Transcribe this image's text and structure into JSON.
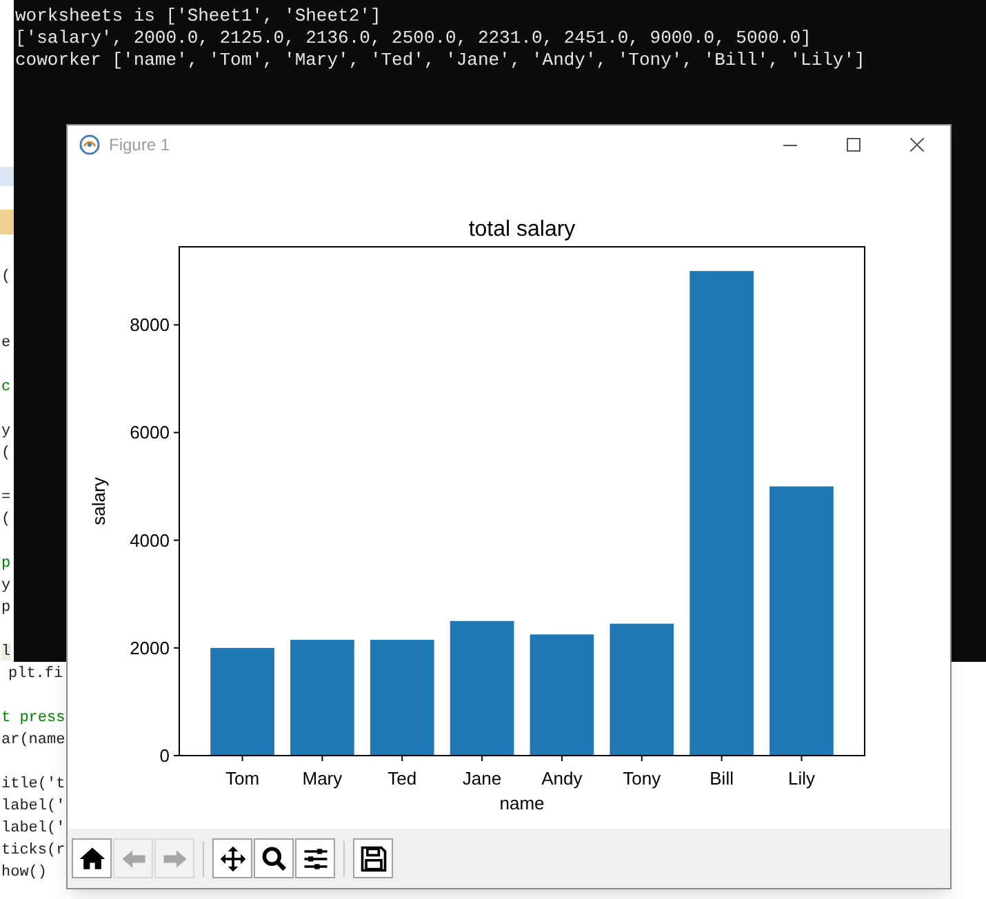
{
  "console": {
    "lines": [
      "worksheets is ['Sheet1', 'Sheet2']",
      "['salary', 2000.0, 2125.0, 2136.0, 2500.0, 2231.0, 2451.0, 9000.0, 5000.0]",
      "coworker ['name', 'Tom', 'Mary', 'Ted', 'Jane', 'Andy', 'Tony', 'Bill', 'Lily']"
    ]
  },
  "editor": {
    "lines": [
      {
        "kind": "code",
        "text": "("
      },
      {
        "kind": "blank"
      },
      {
        "kind": "blank"
      },
      {
        "kind": "code",
        "text": "e"
      },
      {
        "kind": "blank"
      },
      {
        "kind": "comment",
        "text": "c"
      },
      {
        "kind": "blank"
      },
      {
        "kind": "code",
        "text": "y"
      },
      {
        "kind": "code",
        "text": "("
      },
      {
        "kind": "blank"
      },
      {
        "kind": "code",
        "text": "="
      },
      {
        "kind": "code",
        "text": "("
      },
      {
        "kind": "blank"
      },
      {
        "kind": "comment",
        "text": "p"
      },
      {
        "kind": "code",
        "text": "y"
      },
      {
        "kind": "code",
        "text": "p"
      },
      {
        "kind": "blank"
      },
      {
        "kind": "current",
        "text": "l"
      },
      {
        "kind": "indented",
        "text": "plt.fi"
      },
      {
        "kind": "blank"
      },
      {
        "kind": "comment",
        "text": "t press"
      },
      {
        "kind": "code",
        "text": "ar(name"
      },
      {
        "kind": "blank"
      },
      {
        "kind": "code",
        "text": "itle('t"
      },
      {
        "kind": "code",
        "text": "label('"
      },
      {
        "kind": "code",
        "text": "label('"
      },
      {
        "kind": "code",
        "text": "ticks(r"
      },
      {
        "kind": "code",
        "text": "how()"
      }
    ]
  },
  "figure_window": {
    "title": "Figure 1",
    "chart_data": {
      "type": "bar",
      "title": "total salary",
      "xlabel": "name",
      "ylabel": "salary",
      "categories": [
        "Tom",
        "Mary",
        "Ted",
        "Jane",
        "Andy",
        "Tony",
        "Bill",
        "Lily"
      ],
      "series": [
        {
          "color": "#1f77b4",
          "values": [
            2000,
            2150,
            2150,
            2500,
            2250,
            2450,
            9000,
            5000
          ]
        }
      ],
      "ylim": [
        0,
        9450
      ],
      "yticks": [
        0,
        2000,
        4000,
        6000,
        8000
      ]
    },
    "toolbar": [
      {
        "kind": "home",
        "disabled": false
      },
      {
        "kind": "back",
        "disabled": true
      },
      {
        "kind": "forward",
        "disabled": true
      },
      {
        "kind": "separator"
      },
      {
        "kind": "pan",
        "disabled": false
      },
      {
        "kind": "zoom",
        "disabled": false
      },
      {
        "kind": "configure",
        "disabled": false
      },
      {
        "kind": "separator"
      },
      {
        "kind": "save",
        "disabled": false
      }
    ]
  }
}
